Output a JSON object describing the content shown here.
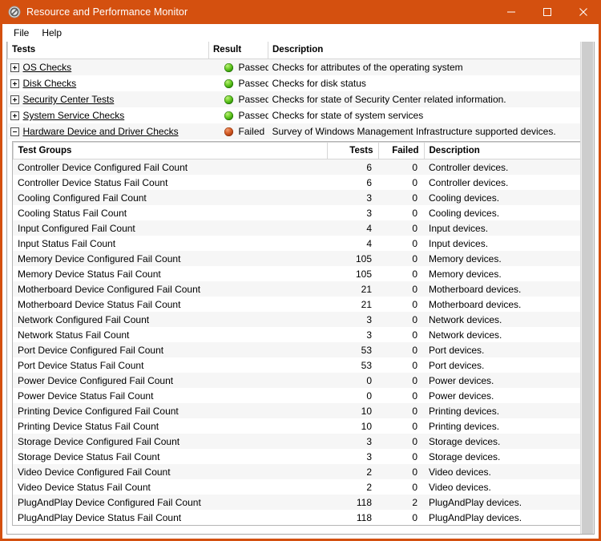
{
  "window": {
    "title": "Resource and Performance Monitor",
    "icon": "no-entry-icon",
    "accent_color": "#d4500f",
    "controls": [
      {
        "name": "minimize-button",
        "glyph": "–"
      },
      {
        "name": "maximize-button",
        "glyph": "□"
      },
      {
        "name": "close-button",
        "glyph": "✕"
      }
    ]
  },
  "menubar": {
    "items": [
      {
        "label": "File"
      },
      {
        "label": "Help"
      }
    ]
  },
  "outer_table": {
    "headers": {
      "tests": "Tests",
      "result": "Result",
      "description": "Description"
    },
    "rows": [
      {
        "expander": "plus",
        "name": "OS Checks",
        "result": "Passed",
        "status": "pass",
        "description": "Checks for attributes of the operating system"
      },
      {
        "expander": "plus",
        "name": "Disk Checks",
        "result": "Passed",
        "status": "pass",
        "description": "Checks for disk status"
      },
      {
        "expander": "plus",
        "name": "Security Center Tests",
        "result": "Passed",
        "status": "pass",
        "description": "Checks for state of Security Center related information."
      },
      {
        "expander": "plus",
        "name": "System Service Checks",
        "result": "Passed",
        "status": "pass",
        "description": "Checks for state of system services"
      },
      {
        "expander": "minus",
        "name": "Hardware Device and Driver Checks",
        "result": "Failed",
        "status": "fail",
        "description": "Survey of Windows Management Infrastructure supported devices."
      }
    ]
  },
  "inner_table": {
    "headers": {
      "group": "Test Groups",
      "tests": "Tests",
      "failed": "Failed",
      "description": "Description"
    },
    "rows": [
      {
        "group": "Controller Device Configured Fail Count",
        "tests": "6",
        "failed": "0",
        "description": "Controller devices."
      },
      {
        "group": "Controller Device Status Fail Count",
        "tests": "6",
        "failed": "0",
        "description": "Controller devices."
      },
      {
        "group": "Cooling Configured Fail Count",
        "tests": "3",
        "failed": "0",
        "description": "Cooling devices."
      },
      {
        "group": "Cooling Status Fail Count",
        "tests": "3",
        "failed": "0",
        "description": "Cooling devices."
      },
      {
        "group": "Input Configured Fail Count",
        "tests": "4",
        "failed": "0",
        "description": "Input devices."
      },
      {
        "group": "Input Status Fail Count",
        "tests": "4",
        "failed": "0",
        "description": "Input devices."
      },
      {
        "group": "Memory Device Configured Fail Count",
        "tests": "105",
        "failed": "0",
        "description": "Memory devices."
      },
      {
        "group": "Memory Device Status Fail Count",
        "tests": "105",
        "failed": "0",
        "description": "Memory devices."
      },
      {
        "group": "Motherboard Device Configured Fail Count",
        "tests": "21",
        "failed": "0",
        "description": "Motherboard devices."
      },
      {
        "group": "Motherboard Device Status Fail Count",
        "tests": "21",
        "failed": "0",
        "description": "Motherboard devices."
      },
      {
        "group": "Network Configured Fail Count",
        "tests": "3",
        "failed": "0",
        "description": "Network devices."
      },
      {
        "group": "Network Status Fail Count",
        "tests": "3",
        "failed": "0",
        "description": "Network devices."
      },
      {
        "group": "Port Device Configured Fail Count",
        "tests": "53",
        "failed": "0",
        "description": "Port devices."
      },
      {
        "group": "Port Device Status Fail Count",
        "tests": "53",
        "failed": "0",
        "description": "Port devices."
      },
      {
        "group": "Power Device Configured Fail Count",
        "tests": "0",
        "failed": "0",
        "description": "Power devices."
      },
      {
        "group": "Power Device Status Fail Count",
        "tests": "0",
        "failed": "0",
        "description": "Power devices."
      },
      {
        "group": "Printing Device Configured Fail Count",
        "tests": "10",
        "failed": "0",
        "description": "Printing devices."
      },
      {
        "group": "Printing Device Status Fail Count",
        "tests": "10",
        "failed": "0",
        "description": "Printing devices."
      },
      {
        "group": "Storage Device Configured Fail Count",
        "tests": "3",
        "failed": "0",
        "description": "Storage devices."
      },
      {
        "group": "Storage Device Status Fail Count",
        "tests": "3",
        "failed": "0",
        "description": "Storage devices."
      },
      {
        "group": "Video Device Configured Fail Count",
        "tests": "2",
        "failed": "0",
        "description": "Video devices."
      },
      {
        "group": "Video Device Status Fail Count",
        "tests": "2",
        "failed": "0",
        "description": "Video devices."
      },
      {
        "group": "PlugAndPlay Device Configured Fail Count",
        "tests": "118",
        "failed": "2",
        "description": "PlugAndPlay devices."
      },
      {
        "group": "PlugAndPlay Device Status Fail Count",
        "tests": "118",
        "failed": "0",
        "description": "PlugAndPlay devices."
      }
    ]
  }
}
